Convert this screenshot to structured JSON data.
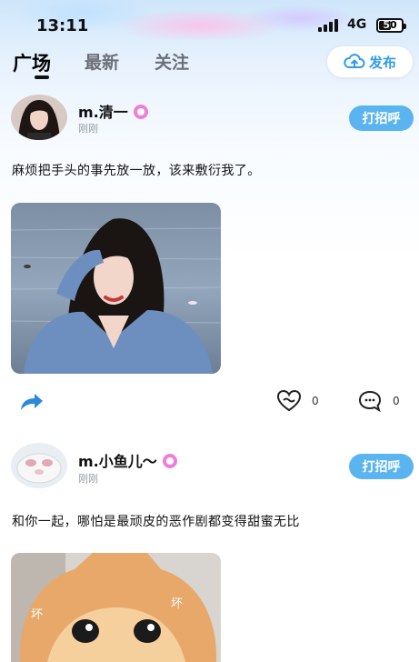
{
  "status_bar": {
    "time": "13:11",
    "network": "4G",
    "battery": "50",
    "battery_level": 0.5
  },
  "tabs": [
    {
      "label": "广场",
      "active": true
    },
    {
      "label": "最新",
      "active": false
    },
    {
      "label": "关注",
      "active": false
    }
  ],
  "publish": {
    "label": "发布",
    "icon": "cloud-upload-icon"
  },
  "posts": [
    {
      "username": "m.清一",
      "time": "刚刚",
      "greet_label": "打招呼",
      "text": "麻烦把手头的事先放一放，该来敷衍我了。",
      "like_count": "0",
      "comment_count": "0"
    },
    {
      "username": "m.小鱼儿～",
      "time": "刚刚",
      "greet_label": "打招呼",
      "text": "和你一起，哪怕是最顽皮的恶作剧都变得甜蜜无比",
      "image_caption_left": "坏",
      "image_caption_right": "坏"
    }
  ],
  "colors": {
    "accent": "#5ab4ef",
    "publish_text": "#2f9be8",
    "vip_badge": "#ef7fd6"
  }
}
